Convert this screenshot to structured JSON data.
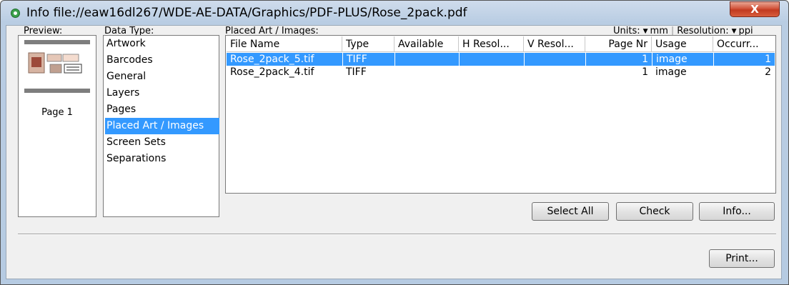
{
  "window": {
    "title": "Info file://eaw16dl267/WDE-AE-DATA/Graphics/PDF-PLUS/Rose_2pack.pdf",
    "close_label": "X"
  },
  "preview": {
    "label": "Preview:",
    "page_label": "Page 1"
  },
  "data_type": {
    "label": "Data Type:",
    "items": [
      "Artwork",
      "Barcodes",
      "General",
      "Layers",
      "Pages",
      "Placed Art / Images",
      "Screen Sets",
      "Separations"
    ],
    "selected": "Placed Art / Images"
  },
  "placed_art": {
    "label": "Placed Art / Images:",
    "units_label": "Units:",
    "units_value": "mm",
    "resolution_label": "Resolution:",
    "resolution_value": "ppi",
    "columns": [
      "File Name",
      "Type",
      "Available",
      "H Resol...",
      "V Resol...",
      "Page Nr",
      "Usage",
      "Occurr..."
    ],
    "rows": [
      {
        "file_name": "Rose_2pack_5.tif",
        "type": "TIFF",
        "available": "",
        "h_resol": "",
        "v_resol": "",
        "page_nr": "1",
        "usage": "image",
        "occurrences": "1",
        "selected": true
      },
      {
        "file_name": "Rose_2pack_4.tif",
        "type": "TIFF",
        "available": "",
        "h_resol": "",
        "v_resol": "",
        "page_nr": "1",
        "usage": "image",
        "occurrences": "2",
        "selected": false
      }
    ]
  },
  "buttons": {
    "select_all": "Select All",
    "check": "Check",
    "info": "Info...",
    "print": "Print..."
  },
  "colors": {
    "selection": "#3399ff",
    "close_button": "#c13a20",
    "title_gradient": "#b9cde3"
  }
}
